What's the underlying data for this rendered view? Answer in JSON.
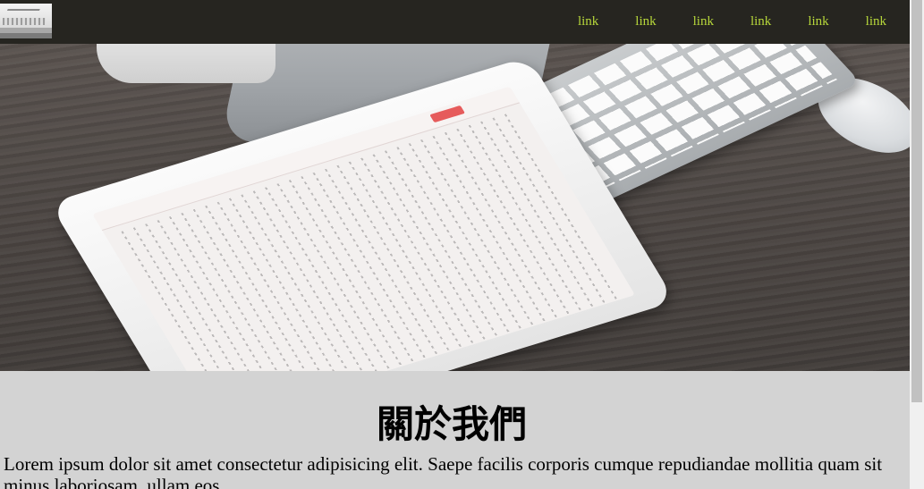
{
  "navbar": {
    "logo_alt": "logo",
    "links": [
      "link",
      "link",
      "link",
      "link",
      "link",
      "link"
    ]
  },
  "hero": {
    "description_icon": "desk-photo"
  },
  "about": {
    "title": "關於我們",
    "body": "Lorem ipsum dolor sit amet consectetur adipisicing elit. Saepe facilis corporis cumque repudiandae mollitia quam sit minus laboriosam, ullam eos."
  },
  "colors": {
    "navbar_bg": "#262520",
    "link_color": "#b6d63a",
    "content_bg": "#d3d3d3"
  }
}
